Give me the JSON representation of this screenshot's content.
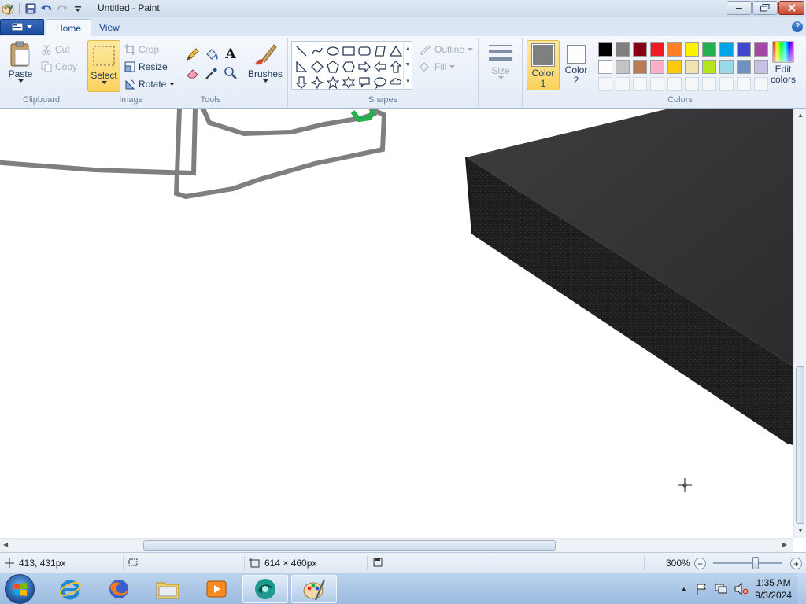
{
  "window": {
    "title": "Untitled - Paint",
    "min_label": "minimize",
    "max_label": "maximize",
    "close_label": "close"
  },
  "tabs": [
    {
      "label": "Home",
      "active": true
    },
    {
      "label": "View",
      "active": false
    }
  ],
  "help_label": "?",
  "ribbon": {
    "clipboard": {
      "label": "Clipboard",
      "paste": "Paste",
      "cut": "Cut",
      "copy": "Copy"
    },
    "image": {
      "label": "Image",
      "select": "Select",
      "crop": "Crop",
      "resize": "Resize",
      "rotate": "Rotate"
    },
    "tools": {
      "label": "Tools",
      "items": [
        "pencil-icon",
        "fill-icon",
        "text-icon",
        "eraser-icon",
        "color-picker-icon",
        "magnifier-icon"
      ],
      "text_glyph": "A"
    },
    "brushes": {
      "label": "Brushes"
    },
    "shapes": {
      "label": "Shapes",
      "outline": "Outline",
      "fill": "Fill"
    },
    "size": {
      "label": "Size"
    },
    "color1": {
      "label1": "Color",
      "label2": "1",
      "color": "#7f7f7f"
    },
    "color2": {
      "label1": "Color",
      "label2": "2",
      "color": "#ffffff"
    },
    "colors": {
      "label": "Colors",
      "row1": [
        "#000000",
        "#7f7f7f",
        "#880015",
        "#ed1c24",
        "#ff7f27",
        "#fff200",
        "#22b14c",
        "#00a2e8",
        "#3f48cc",
        "#a349a4"
      ],
      "row2": [
        "#ffffff",
        "#c3c3c3",
        "#b97a57",
        "#ffaec9",
        "#ffc90e",
        "#efe4b0",
        "#b5e61d",
        "#99d9ea",
        "#7092be",
        "#c8bfe7"
      ],
      "row3": [
        "#f5f7fa",
        "#f5f7fa",
        "#f5f7fa",
        "#f5f7fa",
        "#f5f7fa",
        "#f5f7fa",
        "#f5f7fa",
        "#f5f7fa",
        "#f5f7fa",
        "#f5f7fa"
      ]
    },
    "edit_colors": {
      "line1": "Edit",
      "line2": "colors"
    }
  },
  "status": {
    "cursor_pos": "413, 431px",
    "image_size": "614 × 460px",
    "zoom": "300%"
  },
  "taskbar": {
    "apps": [
      "internet-explorer-icon",
      "firefox-icon",
      "file-explorer-icon",
      "media-player-icon",
      "app-icon",
      "paint-icon"
    ],
    "time": "1:35 AM",
    "date": "9/3/2024"
  }
}
